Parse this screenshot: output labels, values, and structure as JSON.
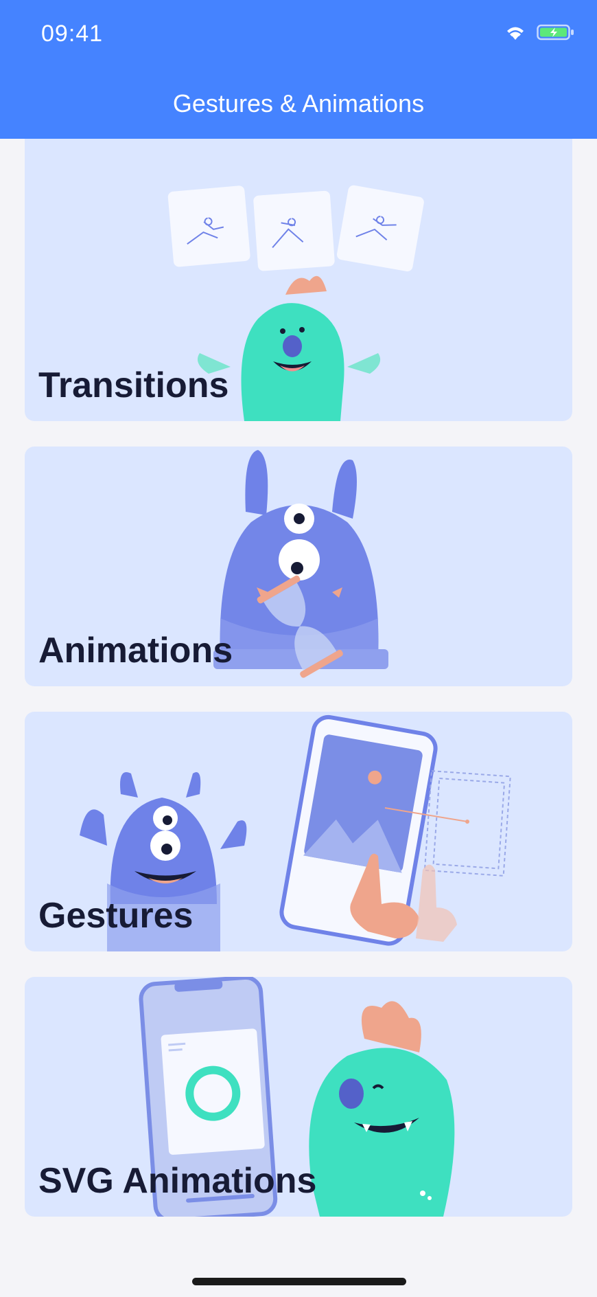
{
  "status": {
    "time": "09:41",
    "wifi_icon": "wifi-icon",
    "battery_icon": "battery-charging-icon"
  },
  "header": {
    "title": "Gestures & Animations"
  },
  "cards": [
    {
      "label": "",
      "illustration": "monster-illustration"
    },
    {
      "label": "Transitions",
      "illustration": "green-monster-with-sketch-cards"
    },
    {
      "label": "Animations",
      "illustration": "blue-monster-with-hourglass"
    },
    {
      "label": "Gestures",
      "illustration": "blue-monster-with-phone-gesture"
    },
    {
      "label": "SVG Animations",
      "illustration": "green-monster-with-phone-ring"
    }
  ],
  "colors": {
    "header": "#4583FF",
    "card": "#DBE6FF",
    "label": "#171B35",
    "green_monster": "#3EE0C0",
    "blue_monster": "#6F82E8",
    "accent": "#EFA58C"
  }
}
